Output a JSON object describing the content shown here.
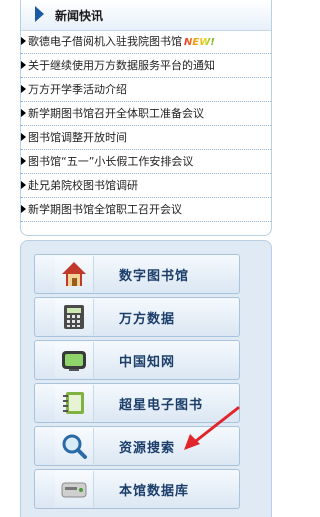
{
  "news": {
    "title": "新闻快讯",
    "new_badge": "NEW!",
    "items": [
      "歌德电子借阅机入驻我院图书馆",
      "关于继续使用万方数据服务平台的通知",
      "万方开学季活动介绍",
      "新学期图书馆召开全体职工准备会议",
      "图书馆调整开放时间",
      "图书馆“五一”小长假工作安排会议",
      "赴兄弟院校图书馆调研",
      "新学期图书馆全馆职工召开会议"
    ]
  },
  "links": [
    {
      "label": "数字图书馆",
      "icon": "home-icon"
    },
    {
      "label": "万方数据",
      "icon": "calculator-icon"
    },
    {
      "label": "中国知网",
      "icon": "monitor-icon"
    },
    {
      "label": "超星电子图书",
      "icon": "notebook-icon"
    },
    {
      "label": "资源搜索",
      "icon": "magnifier-icon"
    },
    {
      "label": "本馆数据库",
      "icon": "disk-drive-icon"
    }
  ],
  "colors": {
    "accent": "#1a5aa6",
    "annotation_arrow": "#e0262a"
  }
}
